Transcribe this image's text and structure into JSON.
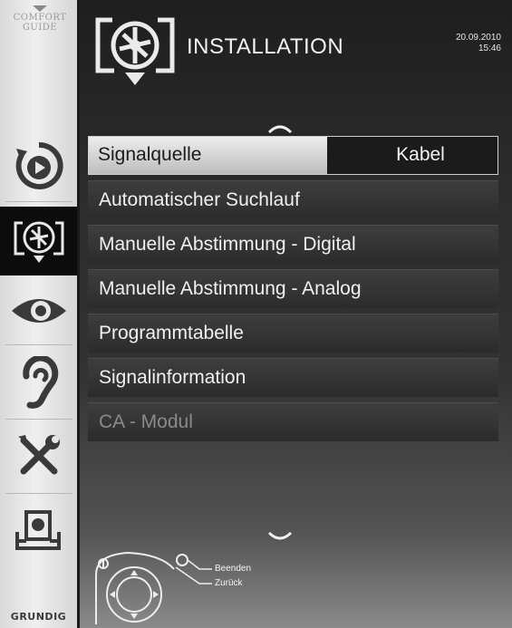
{
  "sidebar": {
    "guide_label_1": "COMFORT",
    "guide_label_2": "GUIDE",
    "brand": "GRUNDIG",
    "items": [
      {
        "name": "source-play-icon",
        "active": false
      },
      {
        "name": "installation-dish-icon",
        "active": true
      },
      {
        "name": "picture-eye-icon",
        "active": false
      },
      {
        "name": "sound-ear-icon",
        "active": false
      },
      {
        "name": "settings-tools-icon",
        "active": false
      },
      {
        "name": "usb-media-icon",
        "active": false
      }
    ]
  },
  "header": {
    "title": "INSTALLATION",
    "date": "20.09.2010",
    "time": "15:46"
  },
  "menu": {
    "items": [
      {
        "label": "Signalquelle",
        "value": "Kabel"
      },
      {
        "label": "Automatischer Suchlauf"
      },
      {
        "label": "Manuelle Abstimmung - Digital"
      },
      {
        "label": "Manuelle Abstimmung - Analog"
      },
      {
        "label": "Programmtabelle"
      },
      {
        "label": "Signalinformation"
      },
      {
        "label": "CA - Modul"
      }
    ]
  },
  "footer": {
    "hint_exit": "Beenden",
    "hint_back": "Zurück"
  },
  "colors": {
    "sidebar_bg": "#e6e6e6",
    "panel_bg": "#2c2c2c",
    "selected_label_bg": "#dcdcdc",
    "disabled_text": "#8a8a8a"
  }
}
